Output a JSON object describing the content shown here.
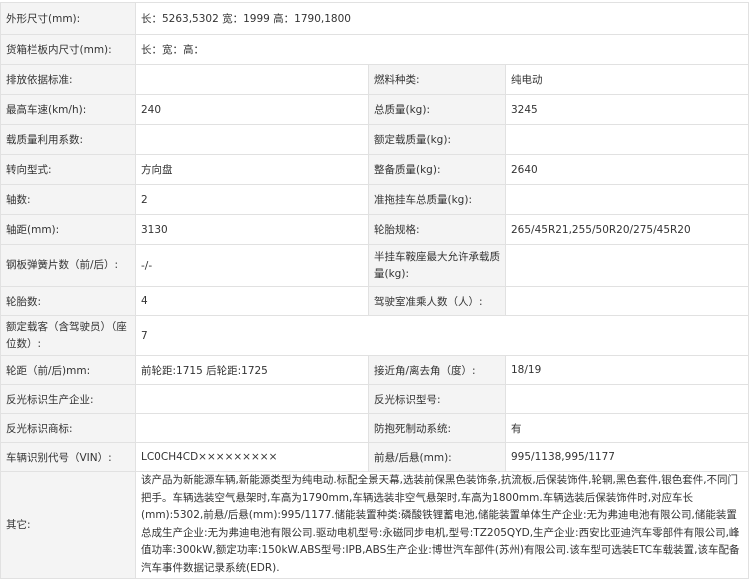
{
  "rows": [
    {
      "l1": "外形尺寸(mm):",
      "v1": "长：5263,5302 宽：1999 高：1790,1800"
    },
    {
      "l1": "货箱栏板内尺寸(mm):",
      "v1": "长：宽：高："
    },
    {
      "l1": "排放依据标准:",
      "v1": "",
      "l2": "燃料种类:",
      "v2": "纯电动"
    },
    {
      "l1": "最高车速(km/h):",
      "v1": "240",
      "l2": "总质量(kg):",
      "v2": "3245"
    },
    {
      "l1": "载质量利用系数:",
      "v1": "",
      "l2": "额定载质量(kg):",
      "v2": ""
    },
    {
      "l1": "转向型式:",
      "v1": "方向盘",
      "l2": "整备质量(kg):",
      "v2": "2640"
    },
    {
      "l1": "轴数:",
      "v1": "2",
      "l2": "准拖挂车总质量(kg):",
      "v2": ""
    },
    {
      "l1": "轴距(mm):",
      "v1": "3130",
      "l2": "轮胎规格:",
      "v2": "265/45R21,255/50R20/275/45R20"
    },
    {
      "l1": "钢板弹簧片数（前/后）:",
      "v1": "-/-",
      "l2": "半挂车鞍座最大允许承载质量(kg):",
      "v2": ""
    },
    {
      "l1": "轮胎数:",
      "v1": "4",
      "l2": "驾驶室准乘人数（人）:",
      "v2": ""
    },
    {
      "l1": "额定载客（含驾驶员）（座位数）:",
      "v1": "7"
    },
    {
      "l1": "轮距（前/后)mm:",
      "v1": "前轮距:1715 后轮距:1725",
      "l2": "接近角/离去角（度）:",
      "v2": "18/19"
    },
    {
      "l1": "反光标识生产企业:",
      "v1": "",
      "l2": "反光标识型号:",
      "v2": ""
    },
    {
      "l1": "反光标识商标:",
      "v1": "",
      "l2": "防抱死制动系统:",
      "v2": "有"
    },
    {
      "l1": "车辆识别代号（VIN）:",
      "v1": "LC0CH4CD×××××××××",
      "l2": "前悬/后悬(mm):",
      "v2": "995/1138,995/1177"
    }
  ],
  "other": {
    "label": "其它:",
    "text": "该产品为新能源车辆,新能源类型为纯电动.标配全景天幕,选装前保黑色装饰条,抗流板,后保装饰件,轮辋,黑色套件,银色套件,不同门把手。车辆选装空气悬架时,车高为1790mm,车辆选装非空气悬架时,车高为1800mm.车辆选装后保装饰件时,对应车长(mm):5302,前悬/后悬(mm):995/1177.储能装置种类:磷酸铁锂蓄电池,储能装置单体生产企业:无为弗迪电池有限公司,储能装置总成生产企业:无为弗迪电池有限公司.驱动电机型号:永磁同步电机,型号:TZ205QYD,生产企业:西安比亚迪汽车零部件有限公司,峰值功率:300kW,额定功率:150kW.ABS型号:IPB,ABS生产企业:博世汽车部件(苏州)有限公司.该车型可选装ETC车载装置,该车配备汽车事件数据记录系统(EDR)."
  }
}
